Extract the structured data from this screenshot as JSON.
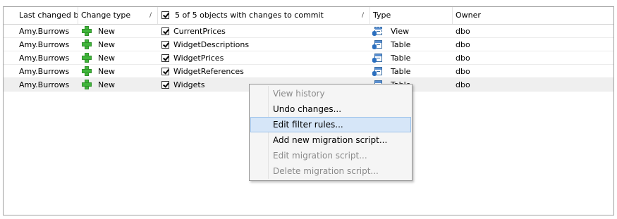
{
  "columns": {
    "last_changed_by": "Last changed by",
    "change_type": "Change type",
    "objects_count": "5 of 5 objects with changes to commit",
    "type": "Type",
    "owner": "Owner",
    "sort_glyph": "/"
  },
  "rows": [
    {
      "user": "Amy.Burrows",
      "change": "New",
      "name": "CurrentPrices",
      "type": "View",
      "owner": "dbo",
      "icon": "view-icon",
      "checked": true
    },
    {
      "user": "Amy.Burrows",
      "change": "New",
      "name": "WidgetDescriptions",
      "type": "Table",
      "owner": "dbo",
      "icon": "table-icon",
      "checked": true
    },
    {
      "user": "Amy.Burrows",
      "change": "New",
      "name": "WidgetPrices",
      "type": "Table",
      "owner": "dbo",
      "icon": "table-icon",
      "checked": true
    },
    {
      "user": "Amy.Burrows",
      "change": "New",
      "name": "WidgetReferences",
      "type": "Table",
      "owner": "dbo",
      "icon": "table-icon",
      "checked": true
    },
    {
      "user": "Amy.Burrows",
      "change": "New",
      "name": "Widgets",
      "type": "Table",
      "owner": "dbo",
      "icon": "table-icon",
      "checked": true
    }
  ],
  "context_menu": {
    "items": [
      {
        "label": "View history",
        "enabled": false
      },
      {
        "label": "Undo changes...",
        "enabled": true
      },
      {
        "label": "Edit filter rules...",
        "enabled": true,
        "highlighted": true
      },
      {
        "label": "Add new migration script...",
        "enabled": true
      },
      {
        "label": "Edit migration script...",
        "enabled": false
      },
      {
        "label": "Delete migration script...",
        "enabled": false
      }
    ]
  },
  "colors": {
    "new_icon": "#3fb53a",
    "menu_highlight": "#d6e6f8",
    "disabled_text": "#8a8a8a"
  }
}
